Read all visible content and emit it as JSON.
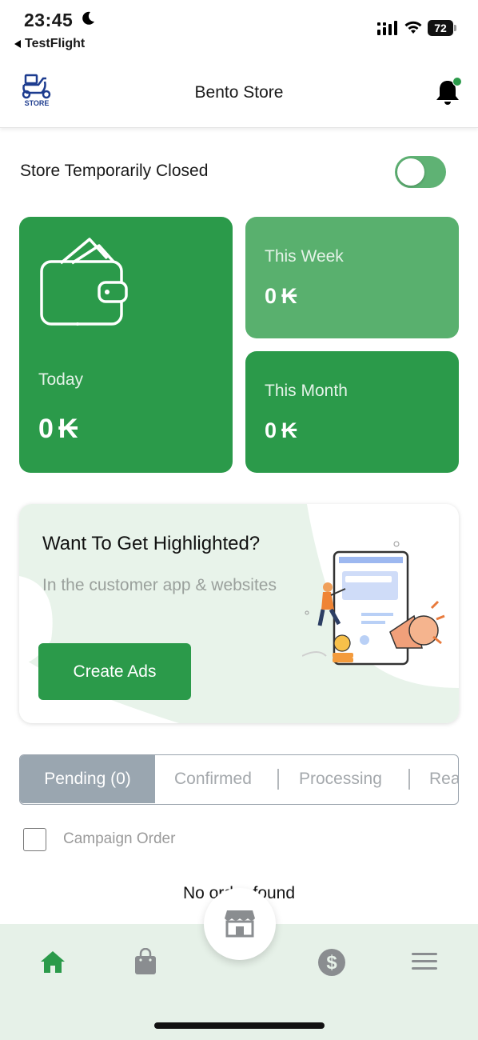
{
  "status_bar": {
    "time": "23:45",
    "back_app": "TestFlight",
    "battery": "72"
  },
  "header": {
    "logo_text": "STORE",
    "title": "Bento Store"
  },
  "store_status": {
    "label": "Store Temporarily Closed",
    "toggle_on": true
  },
  "earnings": {
    "today": {
      "label": "Today",
      "value": "0"
    },
    "week": {
      "label": "This Week",
      "value": "0"
    },
    "month": {
      "label": "This Month",
      "value": "0"
    },
    "currency_symbol": "₭"
  },
  "ads": {
    "title": "Want To Get Highlighted?",
    "subtitle": "In the customer app & websites",
    "button_label": "Create Ads"
  },
  "order_tabs": [
    {
      "label": "Pending (0)",
      "active": true
    },
    {
      "label": "Confirmed",
      "active": false
    },
    {
      "label": "Processing",
      "active": false
    },
    {
      "label": "Ready",
      "active": false
    }
  ],
  "campaign": {
    "label": "Campaign Order",
    "checked": false
  },
  "empty_message": "No order found",
  "bottom_nav": {
    "items": [
      "home-icon",
      "shopping-bag-icon",
      "store-icon",
      "dollar-circle-icon",
      "menu-icon"
    ]
  },
  "colors": {
    "primary": "#2b9a4a",
    "primary_light": "#59b06e",
    "tab_active": "#9aa6b0",
    "nav_bg": "#e6f1e8"
  }
}
